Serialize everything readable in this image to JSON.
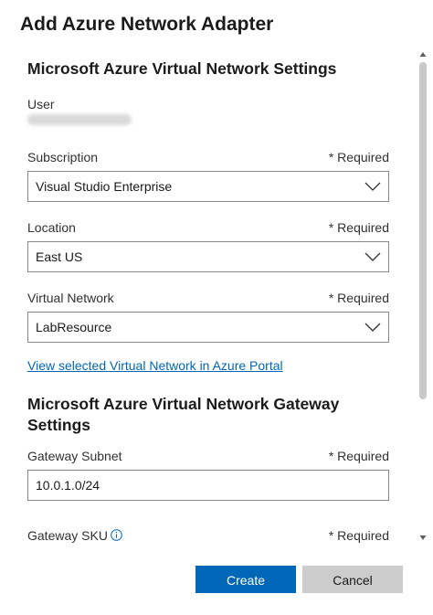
{
  "dialog": {
    "title": "Add Azure Network Adapter"
  },
  "vnet_section": {
    "title": "Microsoft Azure Virtual Network Settings",
    "user_label": "User",
    "subscription": {
      "label": "Subscription",
      "required": "* Required",
      "value": "Visual Studio Enterprise"
    },
    "location": {
      "label": "Location",
      "required": "* Required",
      "value": "East US"
    },
    "virtual_network": {
      "label": "Virtual Network",
      "required": "* Required",
      "value": "LabResource"
    },
    "portal_link": "View selected Virtual Network in Azure Portal"
  },
  "gateway_section": {
    "title": "Microsoft Azure Virtual Network Gateway Settings",
    "subnet": {
      "label": "Gateway Subnet",
      "required": "* Required",
      "value": "10.0.1.0/24"
    },
    "sku": {
      "label": "Gateway SKU",
      "required": "* Required",
      "icon": "info-icon"
    }
  },
  "footer": {
    "create_label": "Create",
    "cancel_label": "Cancel"
  },
  "colors": {
    "primary": "#0067b8",
    "secondary": "#cccccc",
    "link": "#0067b8"
  }
}
